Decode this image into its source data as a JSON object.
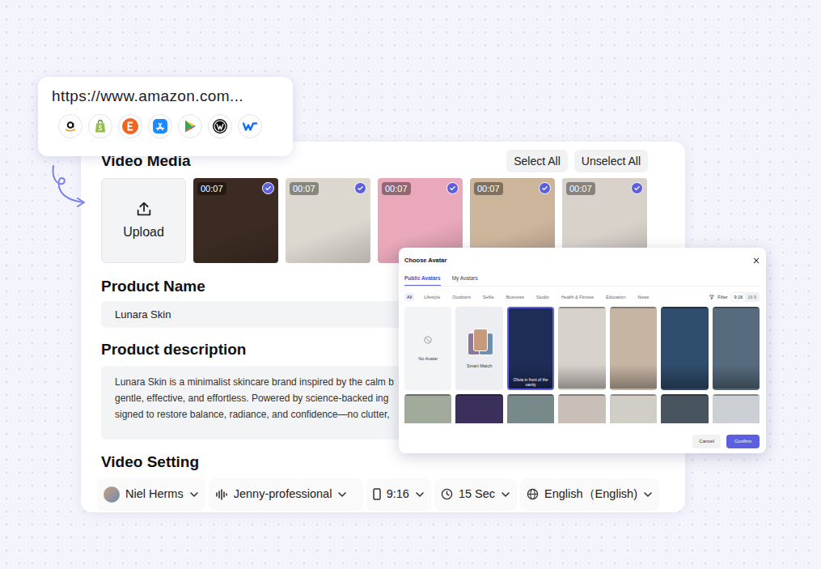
{
  "url_popup": {
    "url": "https://www.amazon.com..."
  },
  "media": {
    "title": "Video Media",
    "select_all": "Select All",
    "unselect_all": "Unselect All",
    "upload": "Upload",
    "clips": [
      {
        "duration": "00:07",
        "selected": true,
        "color": "#3b2b22"
      },
      {
        "duration": "00:07",
        "selected": true,
        "color": "#dcd8d0"
      },
      {
        "duration": "00:07",
        "selected": true,
        "color": "#e9a9bb"
      },
      {
        "duration": "00:07",
        "selected": true,
        "color": "#cdb59c"
      },
      {
        "duration": "00:07",
        "selected": true,
        "color": "#d9d2cb"
      }
    ]
  },
  "product_name": {
    "label": "Product Name",
    "value": "Lunara Skin"
  },
  "description": {
    "label": "Product description",
    "lines": [
      "Lunara Skin is a minimalist skincare brand inspired by the calm b",
      "gentle, effective, and effortless. Powered by science-backed ing",
      "signed to restore balance, radiance, and confidence—no clutter,"
    ]
  },
  "settings": {
    "label": "Video Setting",
    "avatar": "Niel Herms",
    "voice": "Jenny-professional",
    "ratio": "9:16",
    "duration": "15 Sec",
    "language": "English（English)"
  },
  "dialog": {
    "title": "Choose Avatar",
    "tabs": [
      {
        "label": "Public Avatars",
        "selected": true
      },
      {
        "label": "My Avatars",
        "selected": false
      }
    ],
    "categories": [
      {
        "label": "All",
        "selected": true
      },
      {
        "label": "Lifestyle",
        "selected": false
      },
      {
        "label": "Outdoors",
        "selected": false
      },
      {
        "label": "Selfie",
        "selected": false
      },
      {
        "label": "Business",
        "selected": false
      },
      {
        "label": "Studio",
        "selected": false
      },
      {
        "label": "Health & Fitness",
        "selected": false
      },
      {
        "label": "Education",
        "selected": false
      },
      {
        "label": "News",
        "selected": false
      }
    ],
    "filter": "Filter",
    "ratios": [
      {
        "label": "9:16",
        "selected": true
      },
      {
        "label": "16:9",
        "selected": false
      }
    ],
    "tiles": [
      {
        "kind": "none",
        "label": "No Avatar",
        "selected": false
      },
      {
        "kind": "smart",
        "label": "Smart Match",
        "selected": false
      },
      {
        "kind": "photo",
        "label": "Olivia in front of the vanity",
        "selected": true,
        "color": "#1e2c58"
      },
      {
        "kind": "photo",
        "label": "",
        "selected": false,
        "color": "#d8d2cc"
      },
      {
        "kind": "photo",
        "label": "",
        "selected": false,
        "color": "#c7b5a4"
      },
      {
        "kind": "photo",
        "label": "",
        "selected": false,
        "color": "#2f4d6d"
      },
      {
        "kind": "photo",
        "label": "",
        "selected": false,
        "color": "#566b7e"
      },
      {
        "kind": "photo",
        "label": "",
        "selected": false,
        "color": "#a2aa9c"
      },
      {
        "kind": "photo",
        "label": "",
        "selected": false,
        "color": "#3b2f5c"
      },
      {
        "kind": "photo",
        "label": "",
        "selected": false,
        "color": "#78898a"
      },
      {
        "kind": "photo",
        "label": "",
        "selected": false,
        "color": "#c8c0b8"
      },
      {
        "kind": "photo",
        "label": "",
        "selected": false,
        "color": "#d1cdc7"
      },
      {
        "kind": "photo",
        "label": "",
        "selected": false,
        "color": "#485460"
      },
      {
        "kind": "photo",
        "label": "",
        "selected": false,
        "color": "#ccd0d4"
      }
    ],
    "cancel": "Cancel",
    "confirm": "Confirm"
  }
}
